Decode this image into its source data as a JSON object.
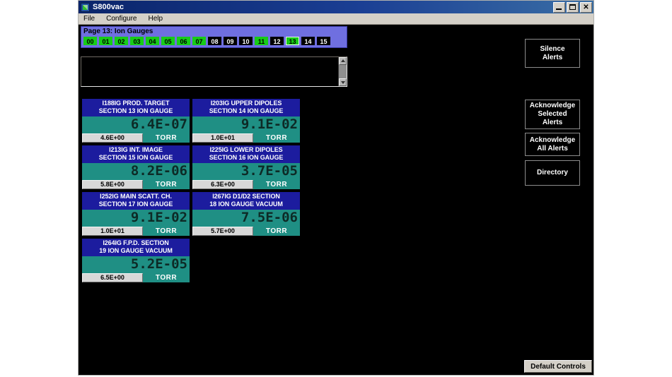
{
  "window": {
    "title": "S800vac",
    "icon": "app-icon",
    "controls": {
      "minimize": "_",
      "maximize": "□",
      "close": "✕"
    }
  },
  "menu": {
    "items": [
      {
        "label": "File"
      },
      {
        "label": "Configure"
      },
      {
        "label": "Help"
      }
    ]
  },
  "pagebar": {
    "title": "Page 13: Ion Gauges",
    "pages": [
      {
        "label": "00",
        "state": "green"
      },
      {
        "label": "01",
        "state": "green"
      },
      {
        "label": "02",
        "state": "green"
      },
      {
        "label": "03",
        "state": "green"
      },
      {
        "label": "04",
        "state": "green"
      },
      {
        "label": "05",
        "state": "green"
      },
      {
        "label": "06",
        "state": "green"
      },
      {
        "label": "07",
        "state": "green"
      },
      {
        "label": "08",
        "state": "dark"
      },
      {
        "label": "09",
        "state": "dark"
      },
      {
        "label": "10",
        "state": "dark"
      },
      {
        "label": "11",
        "state": "green"
      },
      {
        "label": "12",
        "state": "dark"
      },
      {
        "label": "13",
        "state": "selected"
      },
      {
        "label": "14",
        "state": "dark"
      },
      {
        "label": "15",
        "state": "dark"
      }
    ]
  },
  "log": {
    "text": ""
  },
  "gauges": [
    {
      "title_line1": "I188IG PROD. TARGET",
      "title_line2": "SECTION 13 ION GAUGE",
      "value": "6.4E-07",
      "setpoint": "4.6E+00",
      "unit": "TORR"
    },
    {
      "title_line1": "I203IG UPPER DIPOLES",
      "title_line2": "SECTION 14 ION GAUGE",
      "value": "9.1E-02",
      "setpoint": "1.0E+01",
      "unit": "TORR"
    },
    {
      "title_line1": "I213IG INT. IMAGE",
      "title_line2": "SECTION 15 ION GAUGE",
      "value": "8.2E-06",
      "setpoint": "5.8E+00",
      "unit": "TORR"
    },
    {
      "title_line1": "I225IG LOWER DIPOLES",
      "title_line2": "SECTION 16 ION GAUGE",
      "value": "3.7E-05",
      "setpoint": "6.3E+00",
      "unit": "TORR"
    },
    {
      "title_line1": "I252IG  MAIN SCATT. CH.",
      "title_line2": "SECTION 17 ION GAUGE",
      "value": "9.1E-02",
      "setpoint": "1.0E+01",
      "unit": "TORR"
    },
    {
      "title_line1": "I267IG   D1/D2 SECTION",
      "title_line2": "18 ION GAUGE VACUUM",
      "value": "7.5E-06",
      "setpoint": "5.7E+00",
      "unit": "TORR"
    },
    {
      "title_line1": "I264IG  F.P.D. SECTION",
      "title_line2": "19 ION GAUGE VACUUM",
      "value": "5.2E-05",
      "setpoint": "6.5E+00",
      "unit": "TORR"
    }
  ],
  "commands": {
    "silence": {
      "line1": "Silence",
      "line2": "Alerts"
    },
    "ack_selected": {
      "line1": "Acknowledge",
      "line2": "Selected",
      "line3": "Alerts"
    },
    "ack_all": {
      "line1": "Acknowledge",
      "line2": "All Alerts"
    },
    "directory": {
      "line1": "Directory"
    },
    "default_controls": "Default Controls"
  },
  "colors": {
    "panel_header": "#1c1c9e",
    "panel_body": "#1f8f84",
    "page_green": "#17cc17",
    "pagebar_bg": "#6f6fe0",
    "titlebar": "#0a246a"
  }
}
